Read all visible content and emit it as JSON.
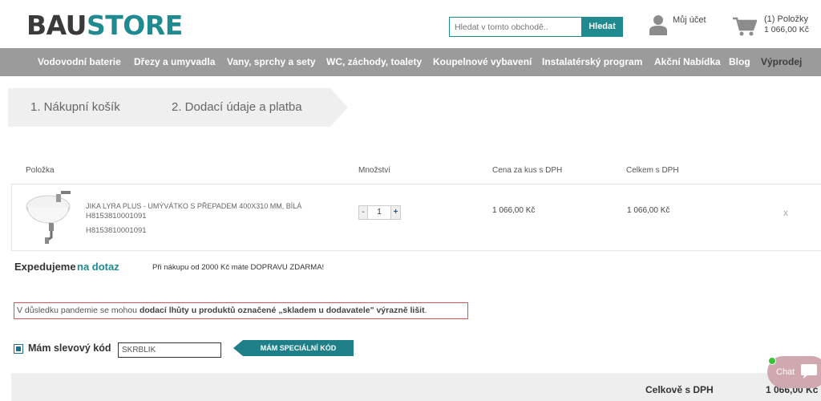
{
  "header": {
    "logo_part1": "BAU",
    "logo_part2": "STORE",
    "search_placeholder": "Hledat v tomto obchodě..",
    "search_button": "Hledat",
    "account_label": "Můj účet",
    "cart_count": "(1) Položky",
    "cart_total": "1 066,00 Kč"
  },
  "nav": {
    "items": [
      "Vodovodní baterie",
      "Dřezy a umyvadla",
      "Vany, sprchy a sety",
      "WC, záchody, toalety",
      "Koupelnové vybavení",
      "Instalatérský program",
      "Akční Nabídka",
      "Blog",
      "Výprodej"
    ]
  },
  "steps": {
    "step1": "1. Nákupní košík",
    "step2": "2. Dodací údaje a platba"
  },
  "cart_table": {
    "headers": [
      "Položka",
      "Množství",
      "Cena za kus s DPH",
      "Celkem s DPH"
    ],
    "rows": [
      {
        "name": "JIKA LYRA PLUS - UMÝVÁTKO S PŘEPADEM 400X310 MM, BÍLÁ",
        "code1": "H8153810001091",
        "code2": "H8153810001091",
        "qty": "1",
        "unit_price": "1 066,00 Kč",
        "total": "1 066,00 Kč",
        "remove": "x"
      }
    ]
  },
  "shipping": {
    "label": "Expedujeme",
    "value": "na dotaz",
    "free_shipping": "Při nákupu od 2000 Kč máte DOPRAVU ZDARMA!"
  },
  "notice": {
    "prefix": "V důsledku pandemie se mohou ",
    "bold": "dodací lhůty u produktů označené „skladem u dodavatele\" výrazně lišit",
    "suffix": "."
  },
  "discount": {
    "label": "Mám slevový kód",
    "input_value": "SKRBLÍK",
    "button": "MÁM SPECIÁLNÍ KÓD"
  },
  "summary": {
    "label": "Celkově s DPH",
    "value": "1 066,00 Kč"
  },
  "chat": {
    "label": "Chat"
  },
  "colors": {
    "accent": "#1f8a8f",
    "nav_bg": "#9b9b9b",
    "notice_border": "#d9534f"
  }
}
